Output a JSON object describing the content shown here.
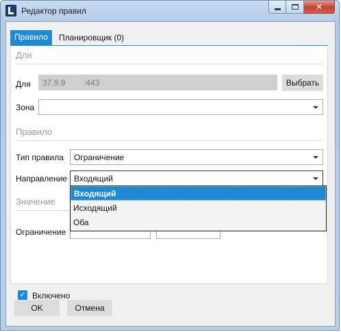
{
  "window": {
    "title": "Редактор правил"
  },
  "window_buttons": {
    "minimize": "—",
    "maximize": "□",
    "close": "✕"
  },
  "tabs": [
    {
      "label": "Правило",
      "active": true
    },
    {
      "label": "Планировщик (0)",
      "active": false
    }
  ],
  "sections": {
    "for": "Для",
    "rule": "Правило",
    "value": "Значение"
  },
  "for_group": {
    "for_label": "Для",
    "for_value": "37.9.9        :443",
    "choose_button": "Выбрать",
    "zone_label": "Зона",
    "zone_value": ""
  },
  "rule_group": {
    "type_label": "Тип правила",
    "type_value": "Ограничение",
    "direction_label": "Направление",
    "direction_value": "Входящий"
  },
  "direction_options": [
    {
      "label": "Входящий",
      "selected": true
    },
    {
      "label": "Исходящий",
      "selected": false
    },
    {
      "label": "Оба",
      "selected": false
    }
  ],
  "value_group": {
    "limit_label": "Ограничение",
    "limit_value": "",
    "unit_value": ""
  },
  "enabled": {
    "label": "Включено",
    "checked": true,
    "check_glyph": "✓"
  },
  "footer": {
    "ok_button": "OK",
    "cancel_button": "Отмена"
  },
  "colors": {
    "accent": "#1e8ad6",
    "title_gradient": "#c9dcf1",
    "close": "#c6412c"
  }
}
